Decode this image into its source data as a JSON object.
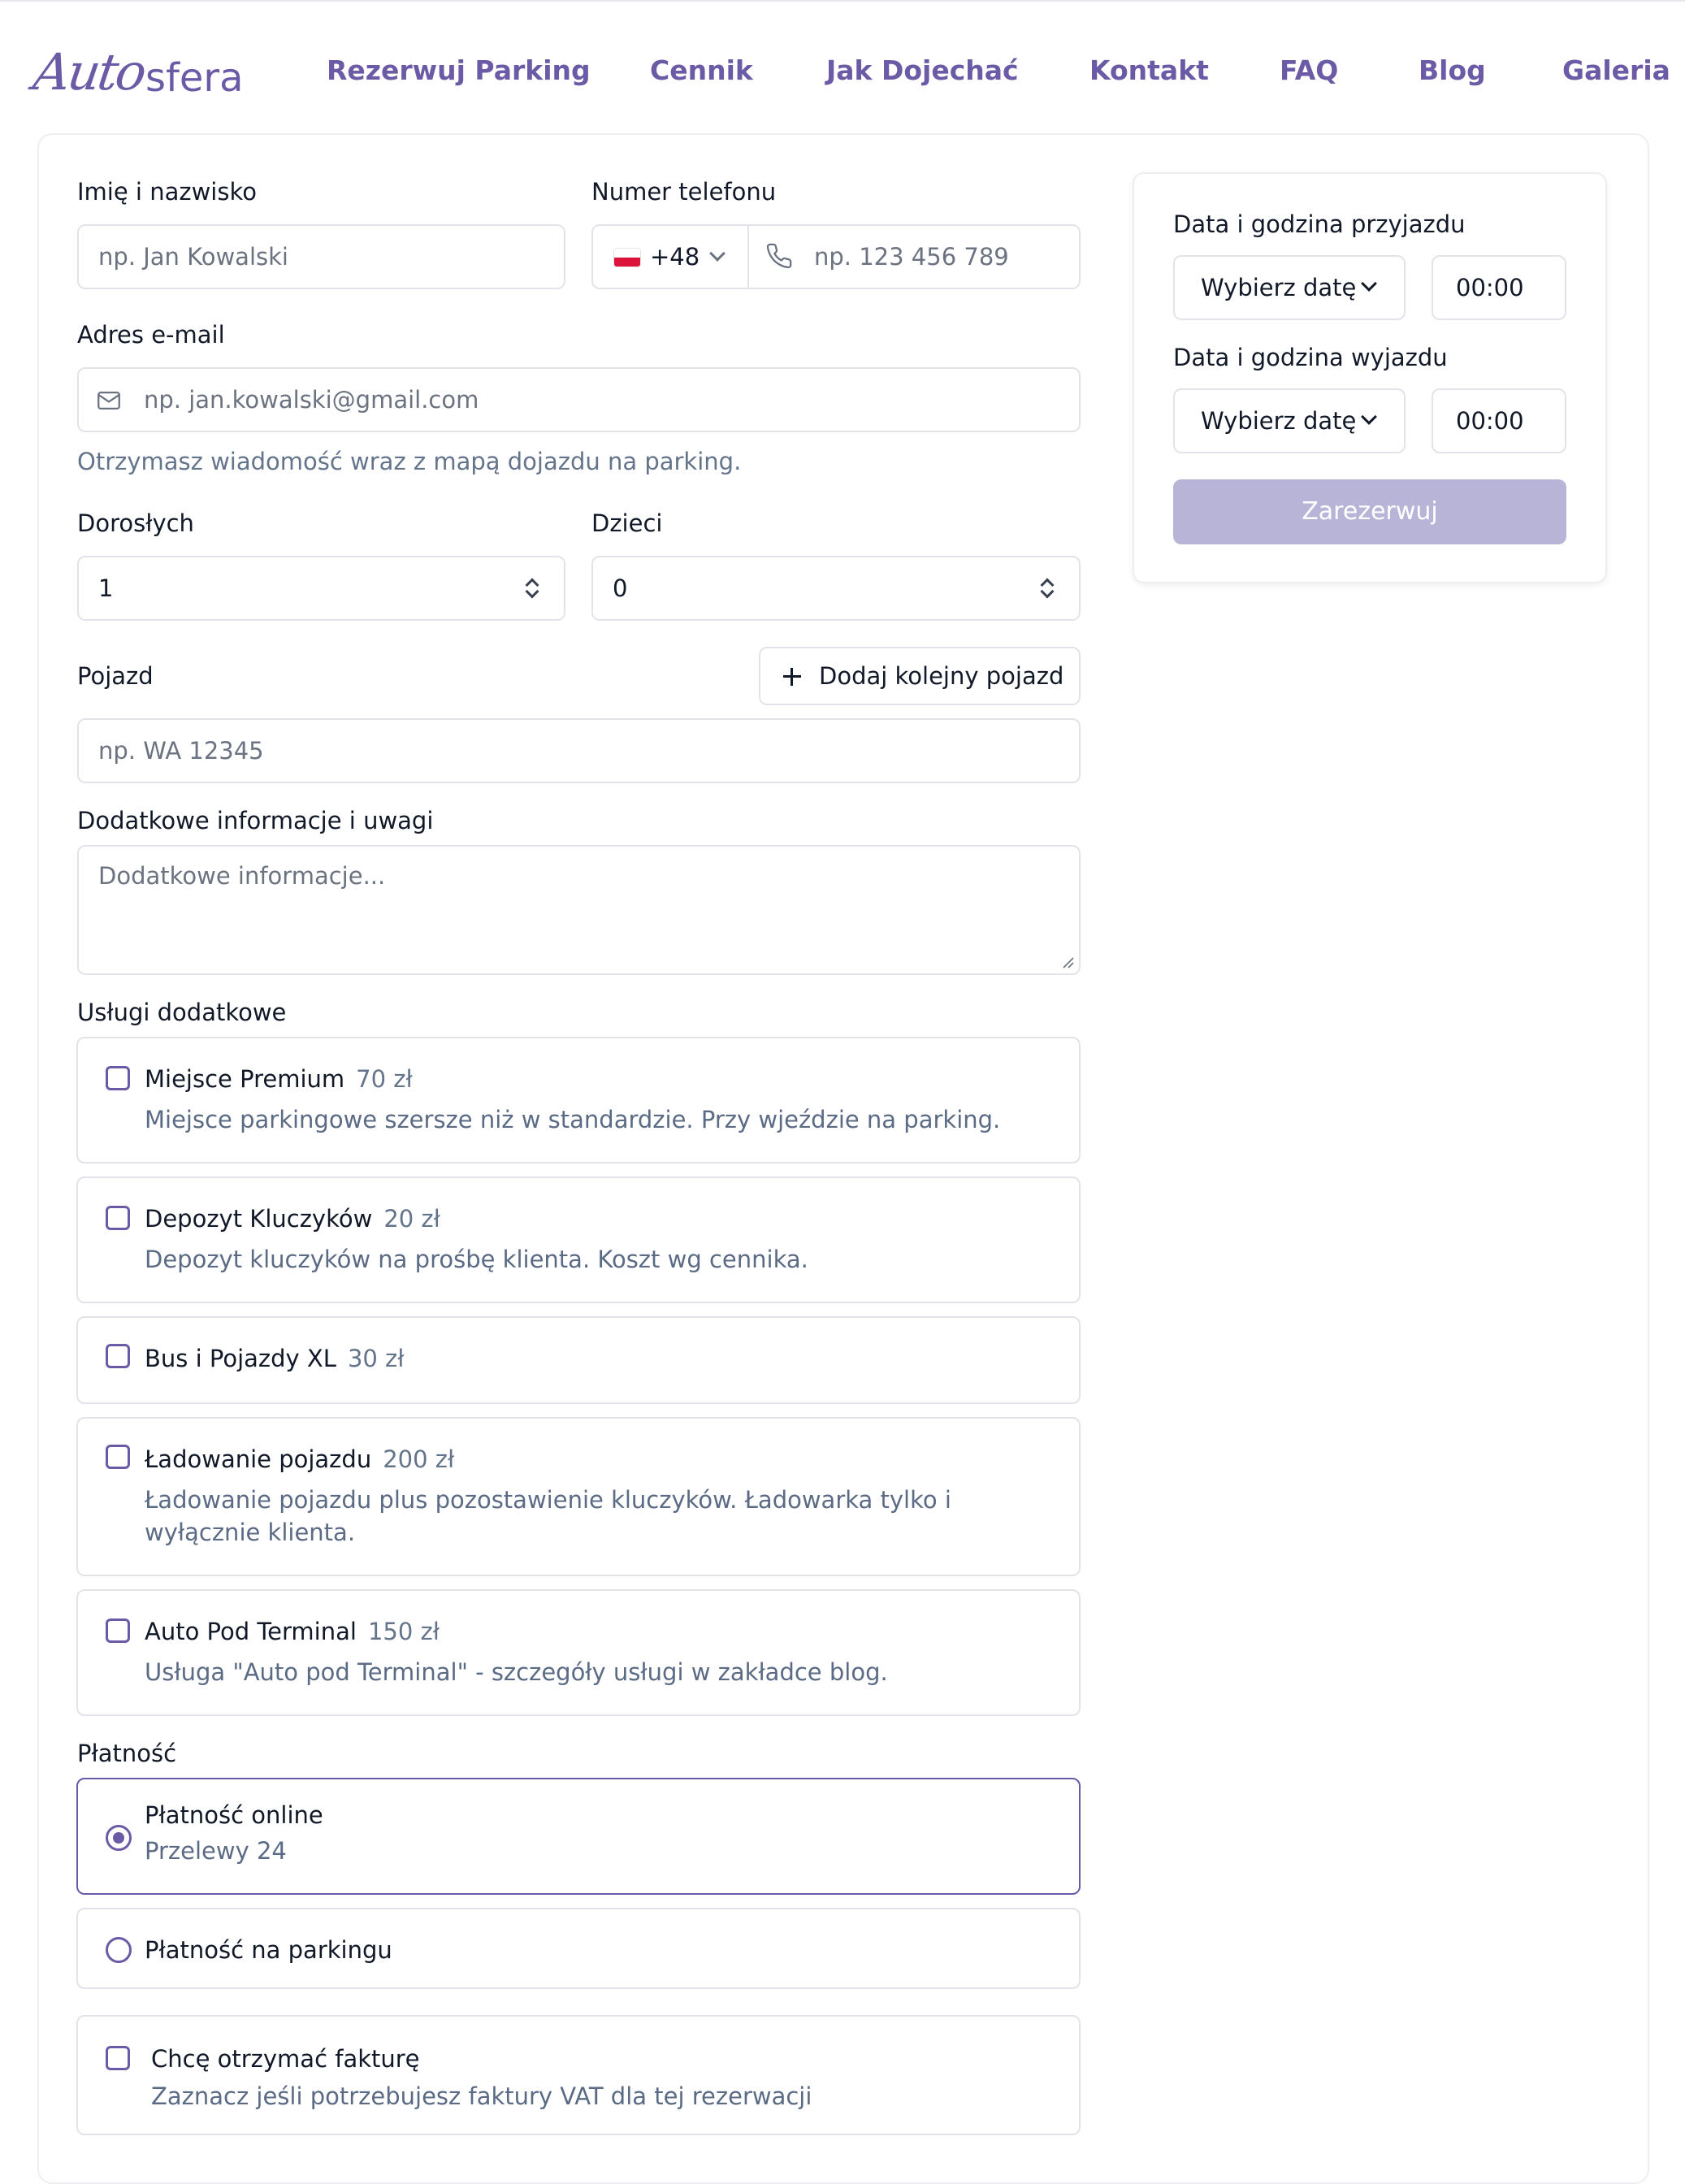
{
  "header": {
    "logo_script": "Auto",
    "logo_rest": "sfera",
    "nav": [
      "Rezerwuj Parking",
      "Cennik",
      "Jak Dojechać",
      "Kontakt",
      "FAQ",
      "Blog",
      "Galeria"
    ]
  },
  "form": {
    "name": {
      "label": "Imię i nazwisko",
      "placeholder": "np. Jan Kowalski"
    },
    "phone": {
      "label": "Numer telefonu",
      "country_code": "+48",
      "placeholder": "np. 123 456 789"
    },
    "email": {
      "label": "Adres e-mail",
      "placeholder": "np. jan.kowalski@gmail.com",
      "hint": "Otrzymasz wiadomość wraz z mapą dojazdu na parking."
    },
    "adults": {
      "label": "Dorosłych",
      "value": "1"
    },
    "children": {
      "label": "Dzieci",
      "value": "0"
    },
    "vehicle": {
      "label": "Pojazd",
      "add_button": "Dodaj kolejny pojazd",
      "placeholder": "np. WA 12345"
    },
    "notes": {
      "label": "Dodatkowe informacje i uwagi",
      "placeholder": "Dodatkowe informacje..."
    },
    "services": {
      "label": "Usługi dodatkowe",
      "items": [
        {
          "title": "Miejsce Premium",
          "price": "70 zł",
          "description": "Miejsce parkingowe szersze niż w standardzie. Przy wjeździe na parking."
        },
        {
          "title": "Depozyt Kluczyków",
          "price": "20 zł",
          "description": "Depozyt kluczyków na prośbę klienta. Koszt wg cennika."
        },
        {
          "title": "Bus i Pojazdy XL",
          "price": "30 zł",
          "description": ""
        },
        {
          "title": "Ładowanie pojazdu",
          "price": "200 zł",
          "description": "Ładowanie pojazdu plus pozostawienie kluczyków. Ładowarka tylko i wyłącznie klienta."
        },
        {
          "title": "Auto Pod Terminal",
          "price": "150 zł",
          "description": "Usługa \"Auto pod Terminal\" - szczegóły usługi w zakładce blog."
        }
      ]
    },
    "payment": {
      "label": "Płatność",
      "online_title": "Płatność online",
      "online_subtitle": "Przelewy 24",
      "onsite_title": "Płatność na parkingu",
      "selected": "online"
    },
    "invoice": {
      "title": "Chcę otrzymać fakturę",
      "description": "Zaznacz jeśli potrzebujesz faktury VAT dla tej rezerwacji"
    }
  },
  "booking": {
    "arrival_label": "Data i godzina przyjazdu",
    "arrival_date": "Wybierz datę",
    "arrival_time": "00:00",
    "departure_label": "Data i godzina wyjazdu",
    "departure_date": "Wybierz datę",
    "departure_time": "00:00",
    "submit": "Zarezerwuj"
  },
  "colors": {
    "accent": "#6b5aa6",
    "submit_disabled": "#b8b4d8",
    "border": "#e2e4ea"
  },
  "icons": [
    "flag-poland-icon",
    "chevron-down-icon",
    "phone-icon",
    "mail-icon",
    "spinner-icon",
    "plus-icon",
    "resize-handle-icon"
  ]
}
